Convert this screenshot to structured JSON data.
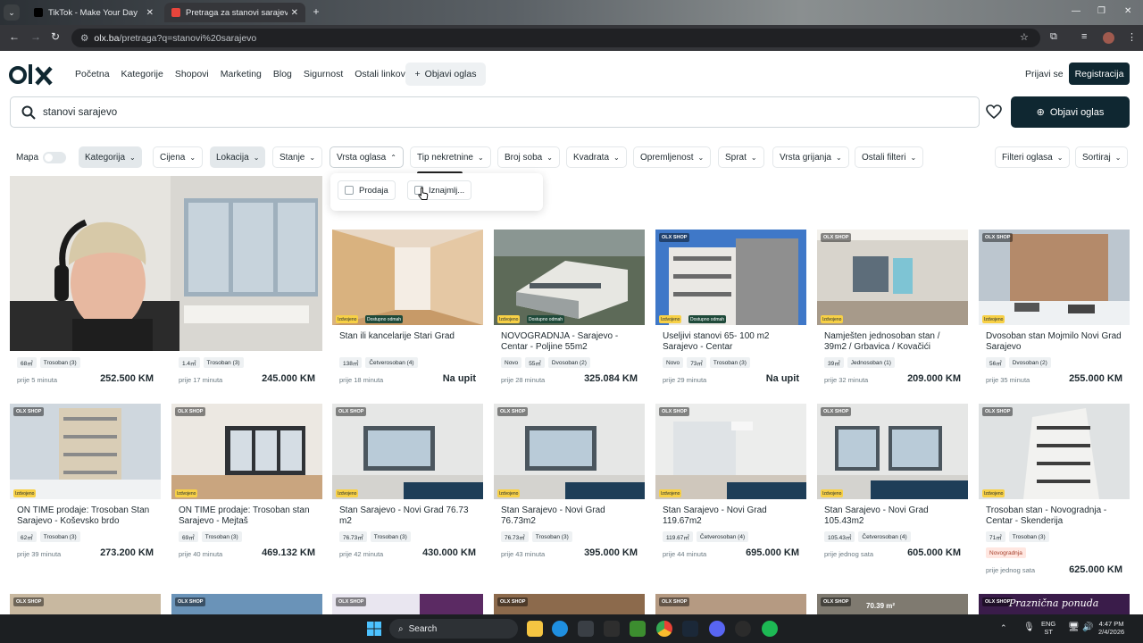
{
  "browser": {
    "tabs": [
      {
        "title": "TikTok - Make Your Day",
        "active": false
      },
      {
        "title": "Pretraga za stanovi sarajevo Ka",
        "active": true
      }
    ],
    "url_host": "olx.ba",
    "url_path": "/pretraga?q=stanovi%20sarajevo"
  },
  "header": {
    "nav": [
      "Početna",
      "Kategorije",
      "Shopovi",
      "Marketing",
      "Blog",
      "Sigurnost",
      "Ostali linkovi"
    ],
    "post_ad_small": "Objavi oglas",
    "login": "Prijavi se",
    "register": "Registracija"
  },
  "search": {
    "query": "stanovi sarajevo",
    "post_ad_button": "Objavi oglas"
  },
  "filters": {
    "map": "Mapa",
    "items": [
      "Kategorija",
      "Cijena",
      "Lokacija",
      "Stanje",
      "Vrsta oglasa",
      "Tip nekretnine",
      "Broj soba",
      "Kvadrata",
      "Opremljenost",
      "Sprat",
      "Vrsta grijanja",
      "Ostali filteri"
    ],
    "ad_filters": "Filteri oglasa",
    "sort": "Sortiraj",
    "dropdown_options": [
      "Prodaja",
      "Iznajmlj..."
    ]
  },
  "badges": {
    "shop": "OLX SHOP",
    "featured": "Izdvojeno",
    "available": "Dostupno odmah"
  },
  "listings": [
    {
      "title": "",
      "tags": [
        "68㎡",
        "Trosoban (3)"
      ],
      "time": "prije 5 minuta",
      "price": "252.500 KM"
    },
    {
      "title": "",
      "tags": [
        "1.4㎡",
        "Trosoban (3)"
      ],
      "time": "prije 17 minuta",
      "price": "245.000 KM"
    },
    {
      "title": "Stan ili kancelarije Stari Grad",
      "tags": [
        "138㎡",
        "Četverosoban (4)"
      ],
      "time": "prije 18 minuta",
      "price": "Na upit"
    },
    {
      "title": "NOVOGRADNJA - Sarajevo - Centar - Poljine 55m2",
      "tags": [
        "Novo",
        "55㎡",
        "Dvosoban (2)"
      ],
      "time": "prije 28 minuta",
      "price": "325.084 KM"
    },
    {
      "title": "Useljivi stanovi 65- 100 m2 Sarajevo - Centar",
      "tags": [
        "Novo",
        "73㎡",
        "Trosoban (3)"
      ],
      "time": "prije 29 minuta",
      "price": "Na upit"
    },
    {
      "title": "Namješten jednosoban stan / 39m2 / Grbavica / Kovačići",
      "tags": [
        "39㎡",
        "Jednosoban (1)"
      ],
      "time": "prije 32 minuta",
      "price": "209.000 KM"
    },
    {
      "title": "Dvosoban stan Mojmilo Novi Grad Sarajevo",
      "tags": [
        "56㎡",
        "Dvosoban (2)"
      ],
      "time": "prije 35 minuta",
      "price": "255.000 KM"
    },
    {
      "title": "ON TIME prodaje: Trosoban Stan Sarajevo - Koševsko brdo",
      "tags": [
        "62㎡",
        "Trosoban (3)"
      ],
      "time": "prije 39 minuta",
      "price": "273.200 KM"
    },
    {
      "title": "ON TIME prodaje: Trosoban stan Sarajevo - Mejtaš",
      "tags": [
        "69㎡",
        "Trosoban (3)"
      ],
      "time": "prije 40 minuta",
      "price": "469.132 KM"
    },
    {
      "title": "Stan Sarajevo - Novi Grad 76.73 m2",
      "tags": [
        "76.73㎡",
        "Trosoban (3)"
      ],
      "time": "prije 42 minuta",
      "price": "430.000 KM"
    },
    {
      "title": "Stan Sarajevo - Novi Grad 76.73m2",
      "tags": [
        "76.73㎡",
        "Trosoban (3)"
      ],
      "time": "prije 43 minuta",
      "price": "395.000 KM"
    },
    {
      "title": "Stan Sarajevo - Novi Grad 119.67m2",
      "tags": [
        "119.67㎡",
        "Četverosoban (4)"
      ],
      "time": "prije 44 minuta",
      "price": "695.000 KM"
    },
    {
      "title": "Stan Sarajevo - Novi Grad 105.43m2",
      "tags": [
        "105.43㎡",
        "Četverosoban (4)"
      ],
      "time": "prije jednog sata",
      "price": "605.000 KM"
    },
    {
      "title": "Trosoban stan - Novogradnja - Centar - Skenderija",
      "tags": [
        "71㎡",
        "Trosoban (3)"
      ],
      "extra_tag": "Novogradnja",
      "time": "prije jednog sata",
      "price": "625.000 KM"
    }
  ],
  "row3_overlay": [
    "70.39 m²",
    "Praznična ponuda"
  ],
  "taskbar": {
    "search": "Search",
    "lang": "ENG",
    "lang2": "ST",
    "time": "4:47 PM",
    "date": "2/4/2026"
  },
  "colors": {
    "brand_dark": "#0f2731",
    "filter_active": "#e3e8eb",
    "card_bg": "#ffffff"
  }
}
